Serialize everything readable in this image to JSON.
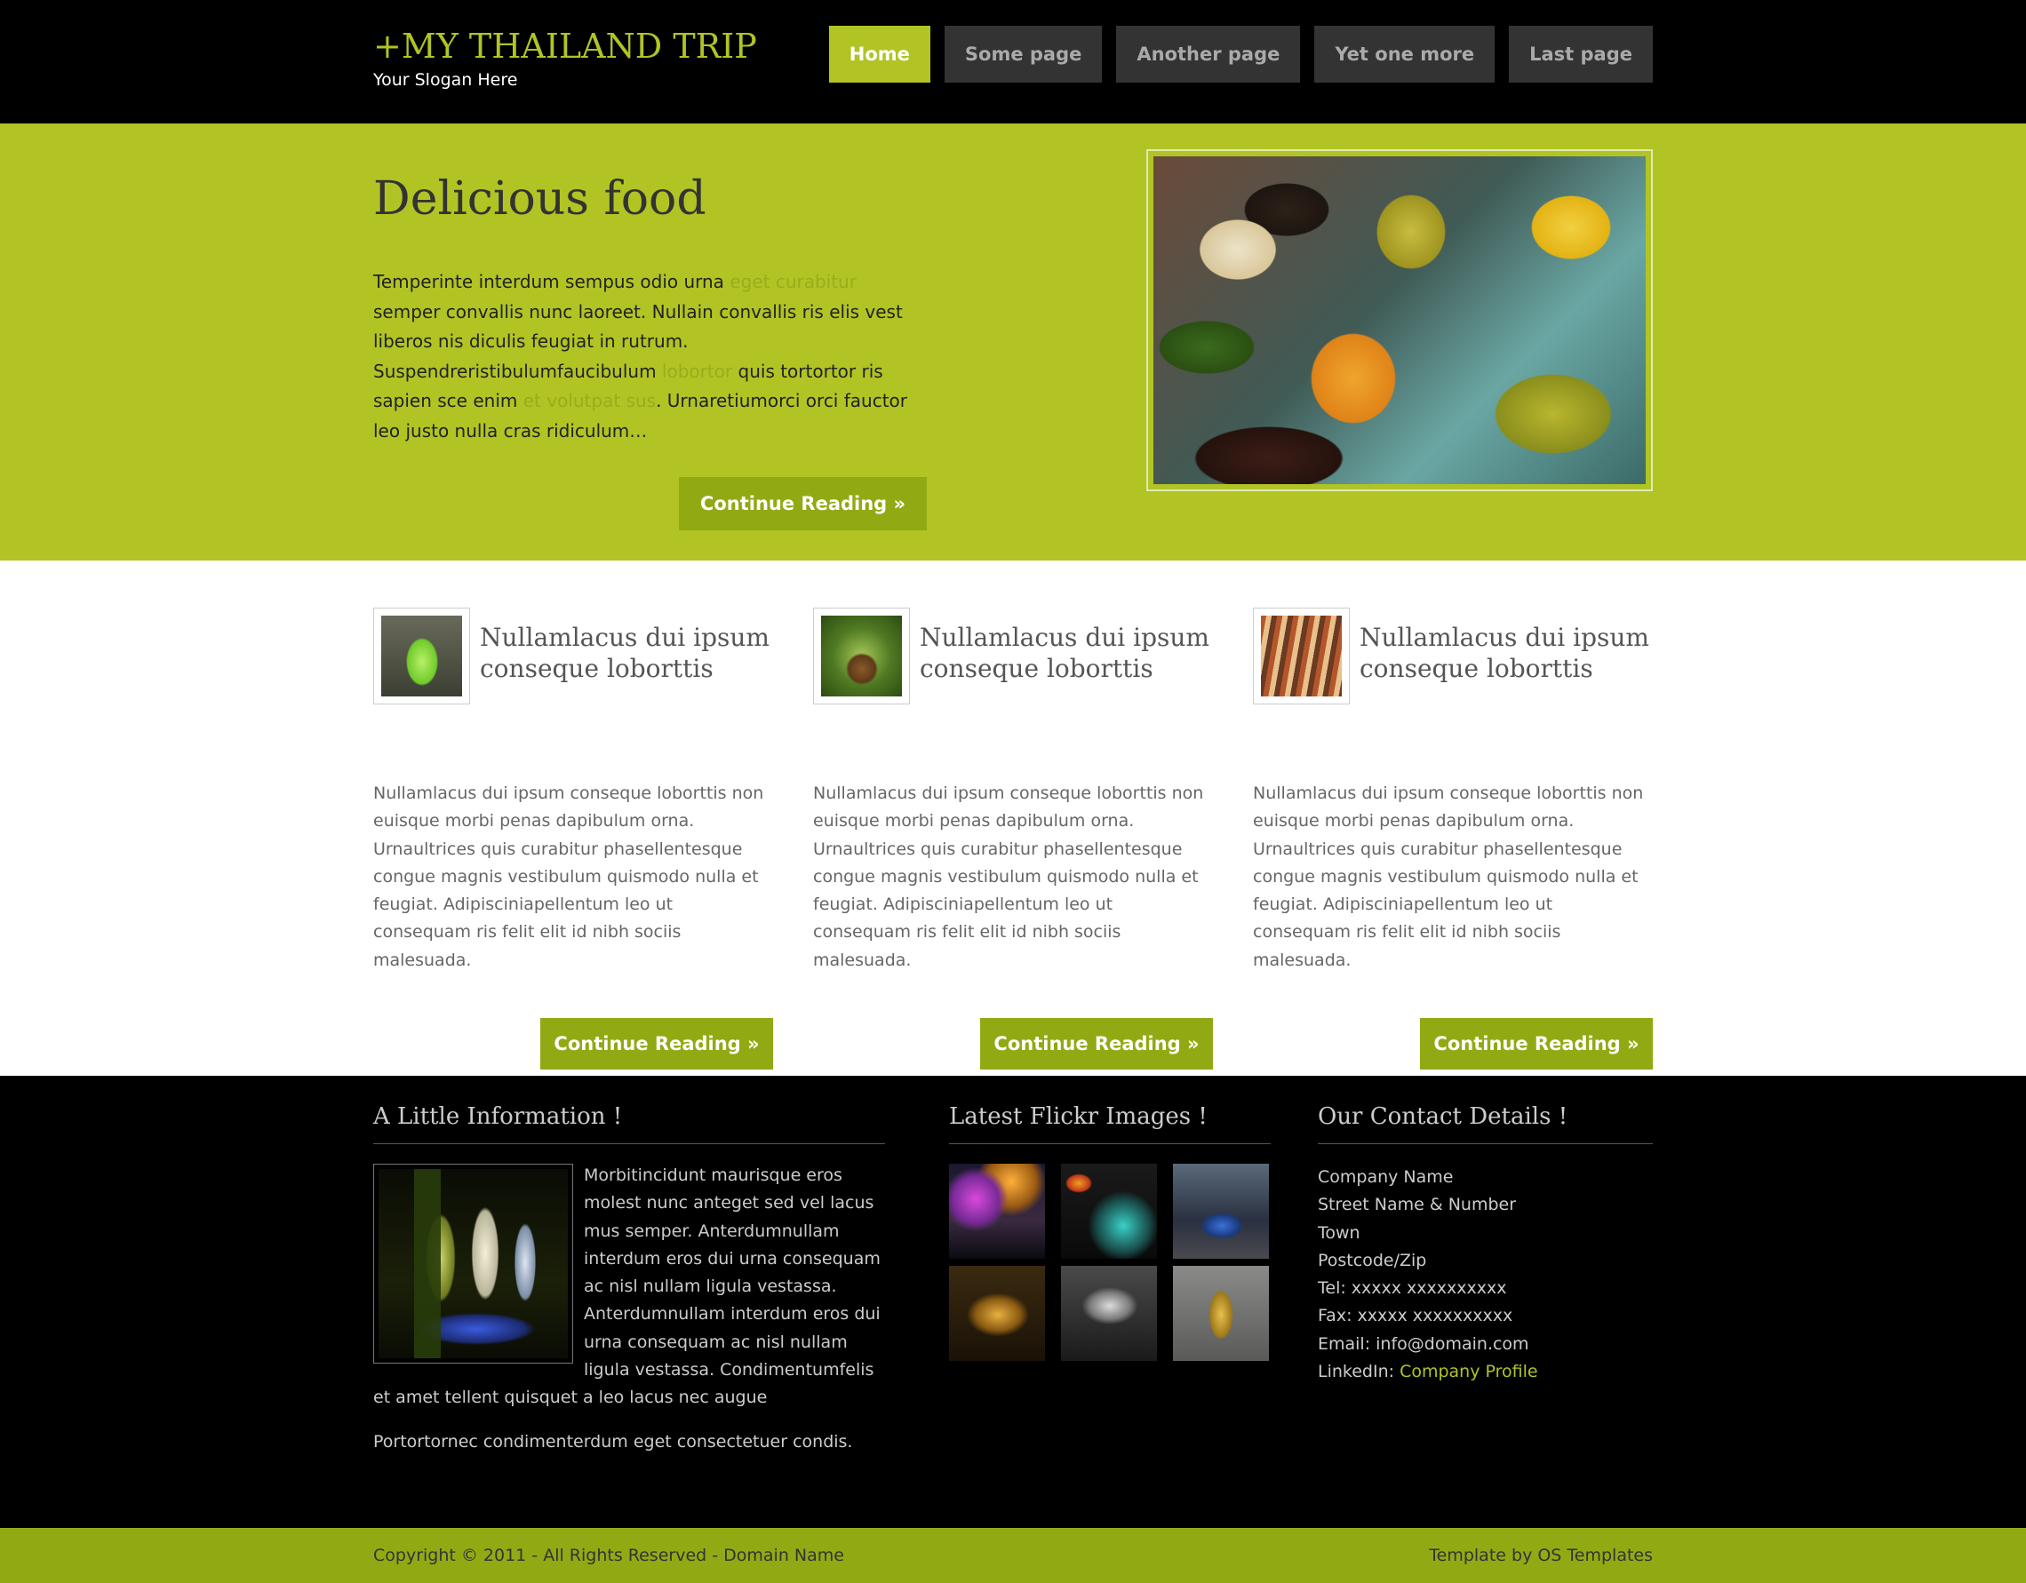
{
  "site": {
    "title": "+MY THAILAND TRIP",
    "slogan": "Your Slogan Here"
  },
  "nav": {
    "items": [
      {
        "label": "Home",
        "active": true
      },
      {
        "label": "Some page",
        "active": false
      },
      {
        "label": "Another page",
        "active": false
      },
      {
        "label": "Yet one more",
        "active": false
      },
      {
        "label": "Last page",
        "active": false
      }
    ]
  },
  "featured": {
    "title": "Delicious food",
    "text_1": "Temperinte interdum sempus odio urna ",
    "link_1": "eget curabitur",
    "text_2": " semper convallis nunc laoreet. Nullain convallis ris elis vest liberos nis diculis feugiat in rutrum. Suspendreristibulumfaucibulum ",
    "link_2": "lobortor",
    "text_3": " quis tortortor ris sapien sce enim ",
    "link_3": "et volutpat sus",
    "text_4": ". Urnaretiumorci orci fauctor leo justo nulla cras ridiculum…",
    "button": "Continue Reading »",
    "image": "market-food-bowls-photo"
  },
  "columns": [
    {
      "title": "Nullamlacus dui ipsum conseque loborttis",
      "text": "Nullamlacus dui ipsum conseque loborttis non euisque morbi penas dapibulum orna. Urnaultrices quis curabitur phasellentesque congue magnis vestibulum quismodo nulla et feugiat. Adipisciniapellentum leo ut consequam ris felit elit id nibh sociis malesuada.",
      "button": "Continue Reading »",
      "image": "green-plant-thumb"
    },
    {
      "title": "Nullamlacus dui ipsum conseque loborttis",
      "text": "Nullamlacus dui ipsum conseque loborttis non euisque morbi penas dapibulum orna. Urnaultrices quis curabitur phasellentesque congue magnis vestibulum quismodo nulla et feugiat. Adipisciniapellentum leo ut consequam ris felit elit id nibh sociis malesuada.",
      "button": "Continue Reading »",
      "image": "palm-tree-thumb"
    },
    {
      "title": "Nullamlacus dui ipsum conseque loborttis",
      "text": "Nullamlacus dui ipsum conseque loborttis non euisque morbi penas dapibulum orna. Urnaultrices quis curabitur phasellentesque congue magnis vestibulum quismodo nulla et feugiat. Adipisciniapellentum leo ut consequam ris felit elit id nibh sociis malesuada.",
      "button": "Continue Reading »",
      "image": "street-food-skewers-thumb"
    }
  ],
  "footer": {
    "info": {
      "title": "A Little Information !",
      "para_1": "Morbitincidunt maurisque eros molest nunc anteget sed vel lacus mus semper. Anterdumnullam interdum eros dui urna consequam ac nisl nullam ligula vestassa. Anterdumnullam interdum eros dui urna consequam ac nisl nullam ligula vestassa. Condimentumfelis et amet tellent quisquet a leo lacus nec augue",
      "para_2": "Portortornec condimenterdum eget consectetuer condis.",
      "image": "bar-bottles-photo"
    },
    "flickr": {
      "title": "Latest Flickr Images !",
      "images": [
        "night-street-neon",
        "burger-king-sign",
        "tuk-tuk-traffic",
        "golden-buddha-face",
        "silver-bowl",
        "golden-buddha-statue"
      ]
    },
    "contact": {
      "title": "Our Contact Details !",
      "lines": [
        "Company Name",
        "Street Name & Number",
        "Town",
        "Postcode/Zip",
        "Tel: xxxxx xxxxxxxxxx",
        "Fax: xxxxx xxxxxxxxxx",
        "Email: info@domain.com"
      ],
      "linkedin_label": "LinkedIn: ",
      "linkedin_link": "Company Profile"
    }
  },
  "copyright": {
    "left": "Copyright © 2011 - All Rights Reserved - Domain Name",
    "right": "Template by OS Templates"
  },
  "colors": {
    "accent": "#b1c424",
    "button": "#91aa14",
    "nav_inactive": "#333333"
  }
}
